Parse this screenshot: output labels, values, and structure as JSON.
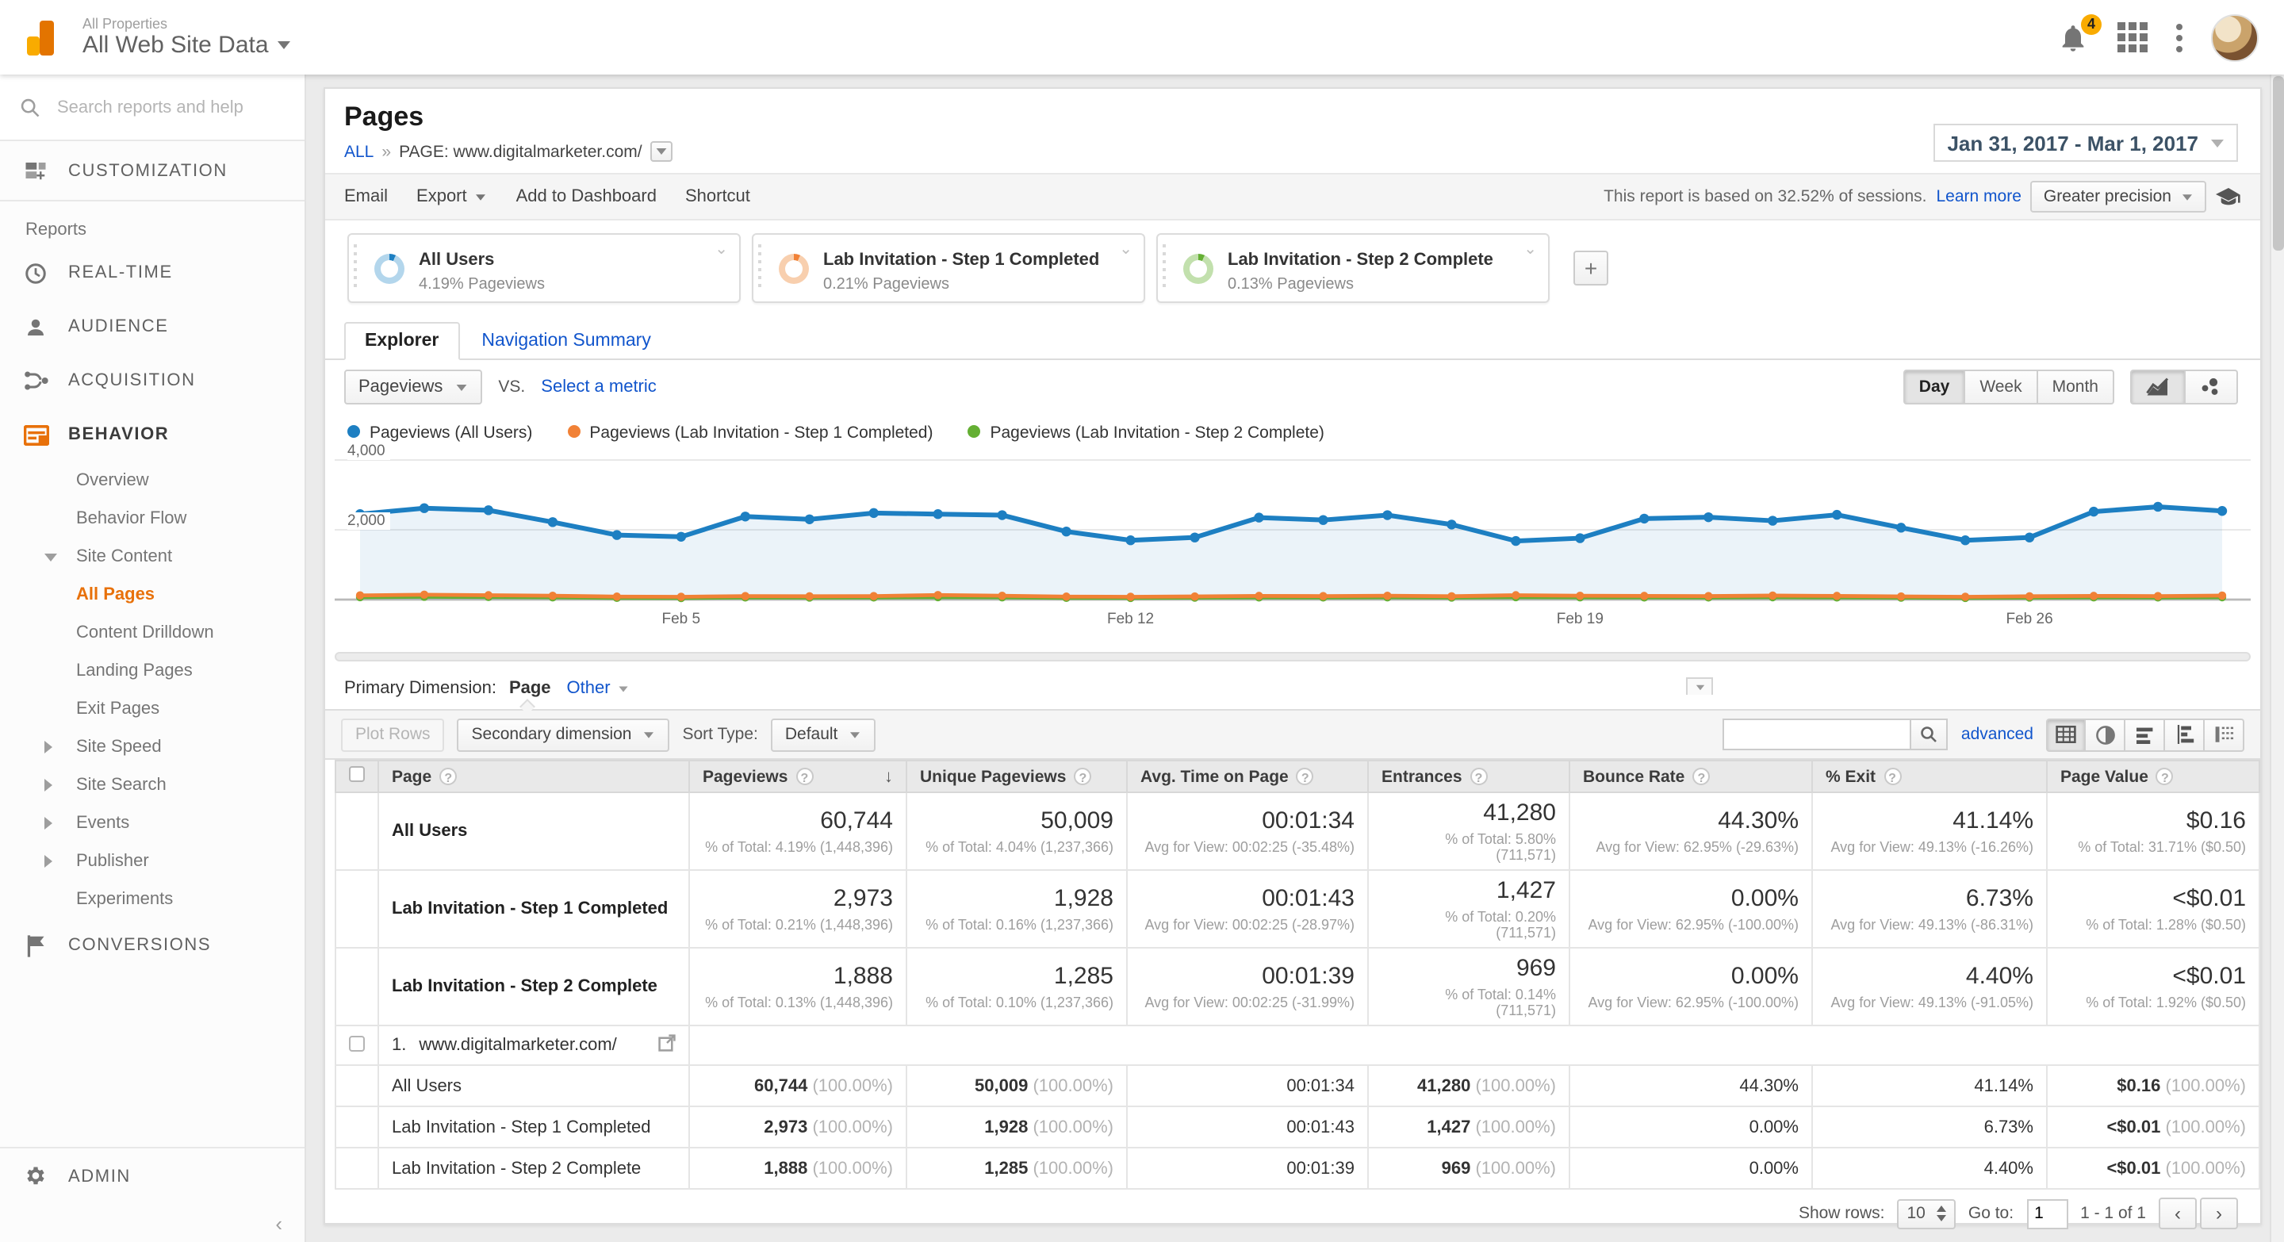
{
  "header": {
    "account_section": "All Properties",
    "account_name": "All Web Site Data",
    "notifications_count": "4"
  },
  "sidebar": {
    "search_placeholder": "Search reports and help",
    "customization_label": "CUSTOMIZATION",
    "reports_label": "Reports",
    "sections": [
      {
        "id": "real-time",
        "label": "REAL-TIME",
        "icon": "clock"
      },
      {
        "id": "audience",
        "label": "AUDIENCE",
        "icon": "person"
      },
      {
        "id": "acquisition",
        "label": "ACQUISITION",
        "icon": "acquisition"
      },
      {
        "id": "behavior",
        "label": "BEHAVIOR",
        "icon": "behavior",
        "active": true,
        "children": [
          {
            "id": "overview",
            "label": "Overview"
          },
          {
            "id": "behavior-flow",
            "label": "Behavior Flow"
          },
          {
            "id": "site-content",
            "label": "Site Content",
            "expanded": true,
            "children": [
              {
                "id": "all-pages",
                "label": "All Pages",
                "active": true
              },
              {
                "id": "content-drilldown",
                "label": "Content Drilldown"
              },
              {
                "id": "landing-pages",
                "label": "Landing Pages"
              },
              {
                "id": "exit-pages",
                "label": "Exit Pages"
              }
            ]
          },
          {
            "id": "site-speed",
            "label": "Site Speed",
            "collapsed": true
          },
          {
            "id": "site-search",
            "label": "Site Search",
            "collapsed": true
          },
          {
            "id": "events",
            "label": "Events",
            "collapsed": true
          },
          {
            "id": "publisher",
            "label": "Publisher",
            "collapsed": true
          },
          {
            "id": "experiments",
            "label": "Experiments"
          }
        ]
      },
      {
        "id": "conversions",
        "label": "CONVERSIONS",
        "icon": "flag"
      }
    ],
    "admin_label": "ADMIN"
  },
  "report": {
    "title": "Pages",
    "breadcrumb": {
      "all": "ALL",
      "separator": "»",
      "page": "PAGE: www.digitalmarketer.com/"
    },
    "actions": {
      "email": "Email",
      "export": "Export",
      "add_to_dashboard": "Add to Dashboard",
      "shortcut": "Shortcut"
    },
    "date_range": "Jan 31, 2017 - Mar 1, 2017",
    "sampling": {
      "text": "This report is based on 32.52% of sessions.",
      "learn_more": "Learn more",
      "precision_button": "Greater precision"
    },
    "segments": [
      {
        "name": "All Users",
        "value": "4.19% Pageviews",
        "color": "#1d7fc2",
        "ring": "#b3d6ec"
      },
      {
        "name": "Lab Invitation - Step 1 Completed",
        "value": "0.21% Pageviews",
        "color": "#f18136",
        "ring": "#f8cfae"
      },
      {
        "name": "Lab Invitation - Step 2 Complete",
        "value": "0.13% Pageviews",
        "color": "#64af33",
        "ring": "#c2e0ad"
      }
    ],
    "tabs": {
      "explorer": "Explorer",
      "navigation_summary": "Navigation Summary"
    },
    "metric_selector": {
      "selected": "Pageviews",
      "vs_label": "VS.",
      "select_link": "Select a metric"
    },
    "granularity": {
      "options": [
        "Day",
        "Week",
        "Month"
      ],
      "active": "Day"
    },
    "primary_dimension": {
      "label": "Primary Dimension:",
      "value": "Page",
      "other_link": "Other"
    }
  },
  "chart_data": {
    "type": "line",
    "title": "Pageviews by day, Jan 31 2017 - Mar 1 2017",
    "x": [
      "Jan 31",
      "Feb 1",
      "Feb 2",
      "Feb 3",
      "Feb 4",
      "Feb 5",
      "Feb 6",
      "Feb 7",
      "Feb 8",
      "Feb 9",
      "Feb 10",
      "Feb 11",
      "Feb 12",
      "Feb 13",
      "Feb 14",
      "Feb 15",
      "Feb 16",
      "Feb 17",
      "Feb 18",
      "Feb 19",
      "Feb 20",
      "Feb 21",
      "Feb 22",
      "Feb 23",
      "Feb 24",
      "Feb 25",
      "Feb 26",
      "Feb 27",
      "Feb 28",
      "Mar 1"
    ],
    "series": [
      {
        "name": "Pageviews (All Users)",
        "color": "#1d7fc2",
        "values": [
          2450,
          2620,
          2560,
          2220,
          1850,
          1800,
          2380,
          2300,
          2480,
          2450,
          2420,
          1950,
          1700,
          1780,
          2350,
          2280,
          2420,
          2150,
          1680,
          1760,
          2320,
          2360,
          2260,
          2430,
          2060,
          1700,
          1780,
          2520,
          2660,
          2540
        ]
      },
      {
        "name": "Pageviews (Lab Invitation - Step 1 Completed)",
        "color": "#f18136",
        "values": [
          120,
          140,
          125,
          110,
          85,
          80,
          100,
          95,
          100,
          130,
          110,
          85,
          80,
          90,
          105,
          100,
          110,
          95,
          125,
          110,
          105,
          100,
          115,
          105,
          90,
          80,
          95,
          105,
          100,
          115
        ]
      },
      {
        "name": "Pageviews (Lab Invitation - Step 2 Complete)",
        "color": "#64af33",
        "values": [
          70,
          80,
          75,
          65,
          50,
          45,
          60,
          58,
          60,
          70,
          65,
          50,
          48,
          55,
          62,
          60,
          65,
          58,
          70,
          65,
          62,
          60,
          68,
          62,
          55,
          48,
          58,
          64,
          60,
          68
        ]
      }
    ],
    "ylim": [
      0,
      4000
    ],
    "yticks": [
      {
        "v": 2000,
        "label": "2,000"
      },
      {
        "v": 4000,
        "label": "4,000"
      }
    ],
    "xticks": [
      {
        "i": 5,
        "label": "Feb 5"
      },
      {
        "i": 12,
        "label": "Feb 12"
      },
      {
        "i": 19,
        "label": "Feb 19"
      },
      {
        "i": 26,
        "label": "Feb 26"
      }
    ],
    "grid": true,
    "legend_position": "top"
  },
  "controls": {
    "plot_rows": "Plot Rows",
    "secondary_dimension": "Secondary dimension",
    "sort_type_label": "Sort Type:",
    "sort_type_value": "Default",
    "search_value": "",
    "advanced_link": "advanced"
  },
  "table": {
    "columns": [
      {
        "label": "Page",
        "sorted": false
      },
      {
        "label": "Pageviews",
        "sorted": true
      },
      {
        "label": "Unique Pageviews",
        "sorted": false
      },
      {
        "label": "Avg. Time on Page",
        "sorted": false
      },
      {
        "label": "Entrances",
        "sorted": false
      },
      {
        "label": "Bounce Rate",
        "sorted": false
      },
      {
        "label": "% Exit",
        "sorted": false
      },
      {
        "label": "Page Value",
        "sorted": false
      }
    ],
    "summary_rows": [
      {
        "label": "All Users",
        "metrics": [
          {
            "v": "60,744",
            "s": "% of Total: 4.19% (1,448,396)"
          },
          {
            "v": "50,009",
            "s": "% of Total: 4.04% (1,237,366)"
          },
          {
            "v": "00:01:34",
            "s": "Avg for View: 00:02:25 (-35.48%)"
          },
          {
            "v": "41,280",
            "s": "% of Total: 5.80% (711,571)"
          },
          {
            "v": "44.30%",
            "s": "Avg for View: 62.95% (-29.63%)"
          },
          {
            "v": "41.14%",
            "s": "Avg for View: 49.13% (-16.26%)"
          },
          {
            "v": "$0.16",
            "s": "% of Total: 31.71% ($0.50)"
          }
        ]
      },
      {
        "label": "Lab Invitation - Step 1 Completed",
        "metrics": [
          {
            "v": "2,973",
            "s": "% of Total: 0.21% (1,448,396)"
          },
          {
            "v": "1,928",
            "s": "% of Total: 0.16% (1,237,366)"
          },
          {
            "v": "00:01:43",
            "s": "Avg for View: 00:02:25 (-28.97%)"
          },
          {
            "v": "1,427",
            "s": "% of Total: 0.20% (711,571)"
          },
          {
            "v": "0.00%",
            "s": "Avg for View: 62.95% (-100.00%)"
          },
          {
            "v": "6.73%",
            "s": "Avg for View: 49.13% (-86.31%)"
          },
          {
            "v": "<$0.01",
            "s": "% of Total: 1.28% ($0.50)"
          }
        ]
      },
      {
        "label": "Lab Invitation - Step 2 Complete",
        "metrics": [
          {
            "v": "1,888",
            "s": "% of Total: 0.13% (1,448,396)"
          },
          {
            "v": "1,285",
            "s": "% of Total: 0.10% (1,237,366)"
          },
          {
            "v": "00:01:39",
            "s": "Avg for View: 00:02:25 (-31.99%)"
          },
          {
            "v": "969",
            "s": "% of Total: 0.14% (711,571)"
          },
          {
            "v": "0.00%",
            "s": "Avg for View: 62.95% (-100.00%)"
          },
          {
            "v": "4.40%",
            "s": "Avg for View: 49.13% (-91.05%)"
          },
          {
            "v": "<$0.01",
            "s": "% of Total: 1.92% ($0.50)"
          }
        ]
      }
    ],
    "page_row": {
      "index": "1.",
      "url": "www.digitalmarketer.com/"
    },
    "sub_rows": [
      {
        "label": "All Users",
        "metrics": [
          {
            "v": "60,744",
            "s": "(100.00%)"
          },
          {
            "v": "50,009",
            "s": "(100.00%)"
          },
          {
            "v": "00:01:34",
            "s": ""
          },
          {
            "v": "41,280",
            "s": "(100.00%)"
          },
          {
            "v": "44.30%",
            "s": ""
          },
          {
            "v": "41.14%",
            "s": ""
          },
          {
            "v": "$0.16",
            "s": "(100.00%)"
          }
        ]
      },
      {
        "label": "Lab Invitation - Step 1 Completed",
        "metrics": [
          {
            "v": "2,973",
            "s": "(100.00%)"
          },
          {
            "v": "1,928",
            "s": "(100.00%)"
          },
          {
            "v": "00:01:43",
            "s": ""
          },
          {
            "v": "1,427",
            "s": "(100.00%)"
          },
          {
            "v": "0.00%",
            "s": ""
          },
          {
            "v": "6.73%",
            "s": ""
          },
          {
            "v": "<$0.01",
            "s": "(100.00%)"
          }
        ]
      },
      {
        "label": "Lab Invitation - Step 2 Complete",
        "metrics": [
          {
            "v": "1,888",
            "s": "(100.00%)"
          },
          {
            "v": "1,285",
            "s": "(100.00%)"
          },
          {
            "v": "00:01:39",
            "s": ""
          },
          {
            "v": "969",
            "s": "(100.00%)"
          },
          {
            "v": "0.00%",
            "s": ""
          },
          {
            "v": "4.40%",
            "s": ""
          },
          {
            "v": "<$0.01",
            "s": "(100.00%)"
          }
        ]
      }
    ]
  },
  "pager": {
    "show_rows_label": "Show rows:",
    "show_rows_value": "10",
    "go_to_label": "Go to:",
    "go_to_value": "1",
    "range_text": "1 - 1 of 1"
  }
}
